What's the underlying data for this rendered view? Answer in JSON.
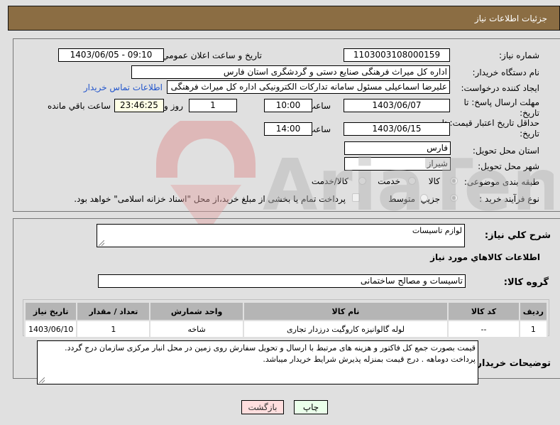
{
  "header": {
    "title": "جزئيات اطلاعات نياز"
  },
  "form": {
    "need_number": {
      "label": "شماره نياز:",
      "value": "1103003108000159"
    },
    "announce_datetime": {
      "label": "تاريخ و ساعت اعلان عمومي:",
      "value": "1403/06/05 - 09:10"
    },
    "buyer_org": {
      "label": "نام دستگاه خريدار:",
      "value": "اداره کل میراث فرهنگی  صنایع دستی و گردشگری استان فارس"
    },
    "requester": {
      "label": "ايجاد کننده درخواست:",
      "value": "علیرضا اسماعیلی مسئول سامانه تدارکات الکترونیکی اداره کل میراث فرهنگی ،",
      "contact_link": "اطلاعات تماس خريدار"
    },
    "response_deadline": {
      "label_line1": "مهلت ارسال پاسخ: تا",
      "label_line2": "تاريخ:",
      "date": "1403/06/07",
      "time_label": "ساعت",
      "time": "10:00",
      "days": "1",
      "days_label": "روز و",
      "remaining": "23:46:25",
      "remaining_label": "ساعت باقي مانده"
    },
    "price_validity": {
      "label_line1": "حداقل تاريخ اعتبار قيمت: تا",
      "label_line2": "تاريخ:",
      "date": "1403/06/15",
      "time_label": "ساعت",
      "time": "14:00"
    },
    "delivery_province": {
      "label": "استان محل تحويل:",
      "value": "فارس"
    },
    "delivery_city": {
      "label": "شهر محل تحويل:",
      "value": "شيراز"
    },
    "category": {
      "label": "طبقه بندی موضوعی:",
      "options": [
        "کالا",
        "خدمت",
        "کالا/خدمت"
      ],
      "selected": "کالا"
    },
    "purchase_type": {
      "label": "نوع فرآيند خريد :",
      "options": [
        "جزيي",
        "متوسط"
      ],
      "selected": "جزيي",
      "treasury_note": "پرداخت تمام يا بخشی از مبلغ خريد،از محل \"اسناد خزانه اسلامی\" خواهد بود."
    }
  },
  "details": {
    "general_desc_label": "شرح کلي نياز:",
    "general_desc": "لوازم تاسیسات",
    "items_title": "اطلاعات کالاهاي مورد نياز",
    "goods_group_label": "گروه کالا:",
    "goods_group": "تاسیسات و مصالح ساختمانی",
    "table": {
      "headers": [
        "رديف",
        "کد کالا",
        "نام کالا",
        "واحد شمارش",
        "تعداد / مقدار",
        "تاريخ نياز"
      ],
      "rows": [
        [
          "1",
          "--",
          "لوله گالوانیزه کاروگیت درزدار تجاری",
          "شاخه",
          "1",
          "1403/06/10"
        ]
      ]
    },
    "buyer_notes_label": "توضيحات خريدار:",
    "buyer_notes": "قیمت بصورت جمع کل فاکتور و هزینه های مرتبط با ارسال و تحویل سفارش روی زمین در محل انبار مرکزی سازمان درج گردد. پرداخت دوماهه . درج قیمت بمنزله پذیرش شرایط خریدار میباشد."
  },
  "buttons": {
    "print": "چاپ",
    "back": "بازگشت"
  },
  "watermark": {
    "text": "AriaTender.neT"
  }
}
